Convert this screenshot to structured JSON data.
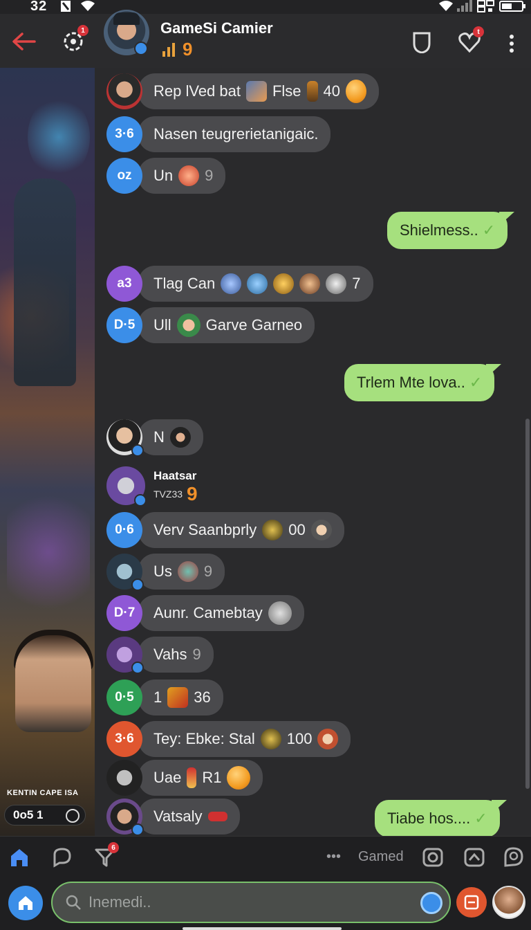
{
  "status_bar": {
    "time": "32",
    "icons": [
      "notification-icon",
      "wifi-icon",
      "signal-icon",
      "battery-icon"
    ]
  },
  "header": {
    "title": "GameSi Camier",
    "subtitle_glyph": "9",
    "back_icon": "arrow-left-icon",
    "group_badge": "1",
    "like_badge": "t",
    "colors": {
      "accent": "#3b8ee8",
      "badge": "#d8333a"
    }
  },
  "side_art": {
    "caption": "KENTIN CAPE ISA",
    "score": "0o5 1"
  },
  "messages": [
    {
      "avatar_text": "",
      "text": "Rep lVed bat",
      "extra": "Flse",
      "count": "40"
    },
    {
      "avatar_text": "3·6",
      "text": "Nasen teugrerietanigaic."
    },
    {
      "avatar_text": "oz",
      "text": "Un",
      "count": "9"
    },
    {
      "avatar_text": "a3",
      "text": "Tlag Can",
      "count": "7"
    },
    {
      "avatar_text": "D·5",
      "text": "Ull",
      "extra": "Garve Garneo"
    },
    {
      "avatar_text": "",
      "text": "N"
    },
    {
      "avatar_text": "0·6",
      "text": "Verv Saanbprly",
      "count": "00"
    },
    {
      "avatar_text": "",
      "text": "Us",
      "count": "9"
    },
    {
      "avatar_text": "D·7",
      "text": "Aunr. Camebtay"
    },
    {
      "avatar_text": "",
      "text": "Vahs",
      "count": "9"
    },
    {
      "avatar_text": "0·5",
      "text": "1",
      "count": "36"
    },
    {
      "avatar_text": "3·6",
      "text": "Tey: Ebke: Stal",
      "count": "100"
    },
    {
      "avatar_text": "",
      "text": "Uae",
      "extra": "R1"
    },
    {
      "avatar_text": "",
      "text": "Vatsaly"
    }
  ],
  "named_post": {
    "name": "Haatsar",
    "sub": "TVZ33",
    "glyph": "9"
  },
  "outgoing": [
    {
      "text": "Shielmess.."
    },
    {
      "text": "Trlem Mte lova.."
    },
    {
      "text": "Tiabe hos...."
    }
  ],
  "bottom_nav": {
    "filter_badge": "6",
    "label": "Gamed"
  },
  "compose": {
    "placeholder": "Inemedi.."
  }
}
